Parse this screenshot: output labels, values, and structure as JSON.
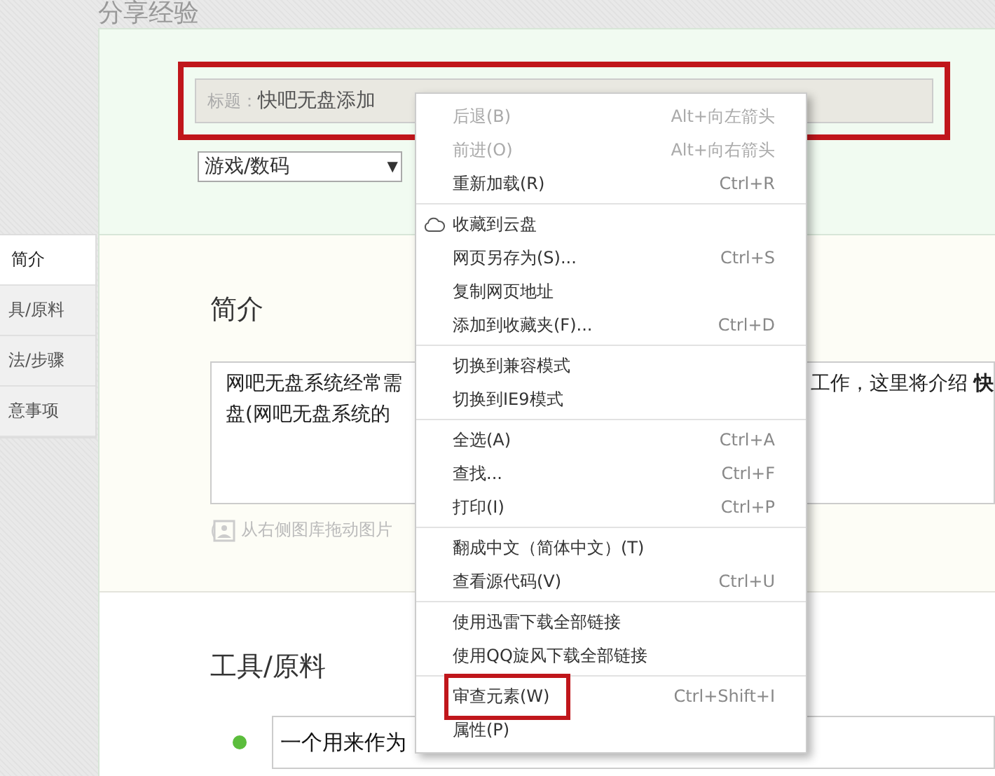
{
  "page_heading": "分享经验",
  "nav": [
    {
      "label": "简介",
      "selected": true
    },
    {
      "label": "具/原料",
      "selected": false
    },
    {
      "label": "法/步骤",
      "selected": false
    },
    {
      "label": "意事项",
      "selected": false
    }
  ],
  "title_field": {
    "placeholder": "标题：",
    "value": "快吧无盘添加",
    "highlighted": true
  },
  "category_select": {
    "value": "游戏/数码",
    "arrow": "▼"
  },
  "intro": {
    "heading": "简介",
    "text_left": [
      "网吧无盘系统经常需",
      "盘(网吧无盘系统的"
    ],
    "text_right": "工作，这里将介绍 **快**",
    "image_hint": "从右侧图库拖动图片"
  },
  "tools": {
    "heading": "工具/原料",
    "items": [
      {
        "text": "一个用来作为",
        "color": "#5bbd3c"
      }
    ]
  },
  "context_menu": {
    "groups": [
      [
        {
          "label": "后退(B)",
          "shortcut": "Alt+向左箭头",
          "disabled": true,
          "highlighted": false
        },
        {
          "label": "前进(O)",
          "shortcut": "Alt+向右箭头",
          "disabled": true,
          "highlighted": false
        },
        {
          "label": "重新加载(R)",
          "shortcut": "Ctrl+R",
          "disabled": false,
          "highlighted": false
        }
      ],
      [
        {
          "label": "收藏到云盘",
          "disabled": false,
          "highlighted": false
        },
        {
          "label": "网页另存为(S)...",
          "shortcut": "Ctrl+S",
          "disabled": false,
          "highlighted": false
        },
        {
          "label": "复制网页地址",
          "disabled": false,
          "highlighted": false
        },
        {
          "label": "添加到收藏夹(F)...",
          "shortcut": "Ctrl+D",
          "disabled": false,
          "highlighted": false
        }
      ],
      [
        {
          "label": "切换到兼容模式",
          "disabled": false,
          "highlighted": false
        },
        {
          "label": "切换到IE9模式",
          "disabled": false,
          "highlighted": false
        }
      ],
      [
        {
          "label": "全选(A)",
          "shortcut": "Ctrl+A",
          "disabled": false,
          "highlighted": false
        },
        {
          "label": "查找...",
          "shortcut": "Ctrl+F",
          "disabled": false,
          "highlighted": false
        },
        {
          "label": "打印(I)",
          "shortcut": "Ctrl+P",
          "disabled": false,
          "highlighted": false
        }
      ],
      [
        {
          "label": "翻成中文（简体中文）(T)",
          "disabled": false,
          "highlighted": false
        },
        {
          "label": "查看源代码(V)",
          "shortcut": "Ctrl+U",
          "disabled": false,
          "highlighted": false
        }
      ],
      [
        {
          "label": "使用迅雷下载全部链接",
          "disabled": false,
          "highlighted": false
        },
        {
          "label": "使用QQ旋风下载全部链接",
          "disabled": false,
          "highlighted": false
        }
      ],
      [
        {
          "label": "审查元素(W)",
          "shortcut": "Ctrl+Shift+I",
          "disabled": false,
          "highlighted": true
        },
        {
          "label": "属性(P)",
          "disabled": false,
          "highlighted": false
        }
      ]
    ]
  }
}
